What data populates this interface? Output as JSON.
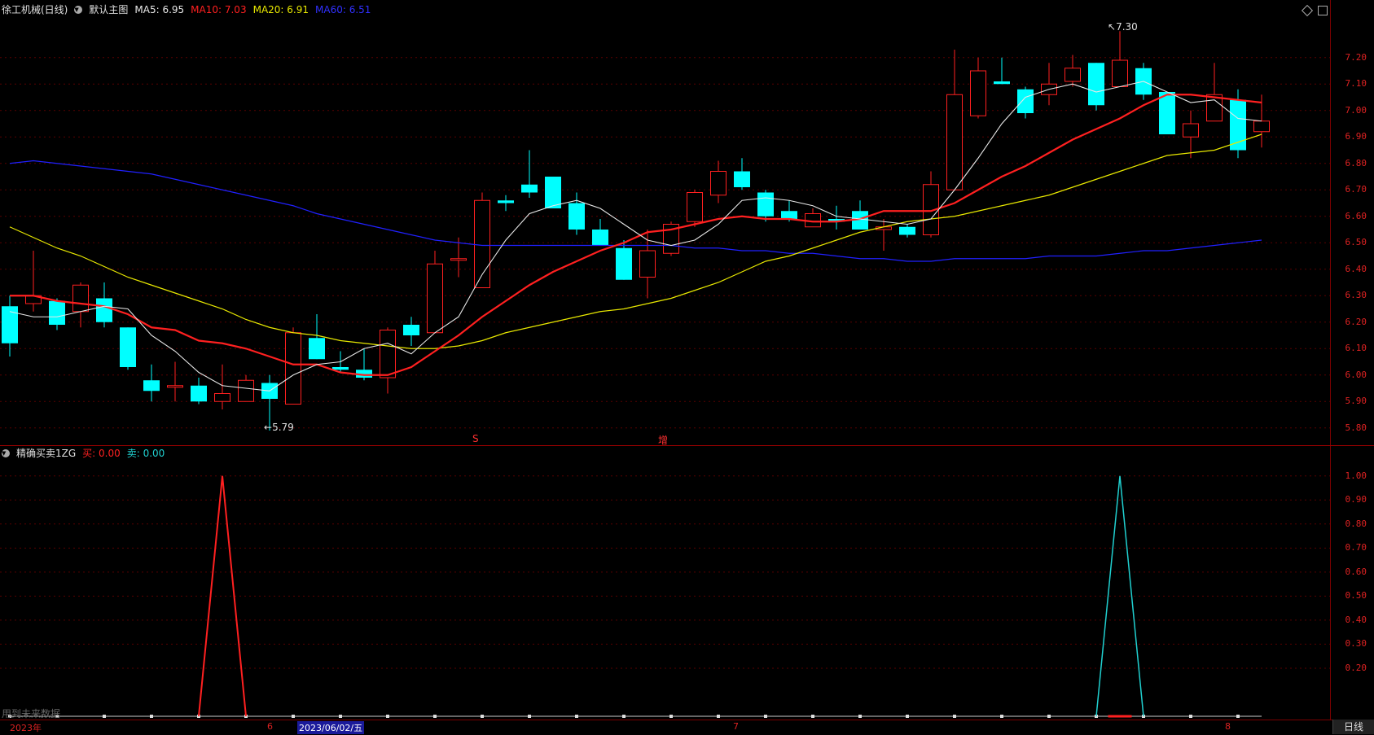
{
  "main_header": {
    "title": "徐工机械(日线)",
    "template_label": "默认主图",
    "template_icon": "chevron-down-icon",
    "ma5": {
      "label": "MA5: 6.95",
      "color": "#e8e8e8"
    },
    "ma10": {
      "label": "MA10: 7.03",
      "color": "#ff2020"
    },
    "ma20": {
      "label": "MA20: 6.91",
      "color": "#e8e800"
    },
    "ma60": {
      "label": "MA60: 6.51",
      "color": "#2020ff"
    }
  },
  "window_controls": {
    "diamond_icon": "diamond-icon",
    "maximize_icon": "window-icon"
  },
  "price_axis": {
    "min": 5.75,
    "max": 7.35,
    "labels": [
      "7.20",
      "7.10",
      "7.00",
      "6.90",
      "6.80",
      "6.70",
      "6.60",
      "6.50",
      "6.40",
      "6.30",
      "6.20",
      "6.10",
      "6.00",
      "5.90",
      "5.80"
    ]
  },
  "price_annotations": {
    "high": "7.30",
    "low": "5.79",
    "event_s": "S",
    "event_zeng": "增"
  },
  "indicator_header": {
    "title": "精确买卖1ZG",
    "buy_label": "买: 0.00",
    "sell_label": "卖: 0.00",
    "buy_color": "#ff2020",
    "sell_color": "#20d0d0"
  },
  "indicator_axis": {
    "labels": [
      "1.00",
      "0.90",
      "0.80",
      "0.70",
      "0.60",
      "0.50",
      "0.40",
      "0.30",
      "0.20"
    ]
  },
  "footer": {
    "year_label": "2023年",
    "m6": "6",
    "selected_date": "2023/06/02/五",
    "m7": "7",
    "m8": "8",
    "mode": "日线",
    "watermark": "用到未来数据"
  },
  "chart_data": {
    "type": "candlestick",
    "up_color": "#ff2020",
    "down_color": "#00ffff",
    "candles": [
      [
        6.26,
        6.12,
        6.3,
        6.07
      ],
      [
        6.27,
        6.3,
        6.47,
        6.24
      ],
      [
        6.28,
        6.19,
        6.29,
        6.17
      ],
      [
        6.24,
        6.34,
        6.35,
        6.18
      ],
      [
        6.29,
        6.2,
        6.35,
        6.18
      ],
      [
        6.18,
        6.03,
        6.18,
        6.02
      ],
      [
        5.98,
        5.94,
        6.04,
        5.9
      ],
      [
        5.96,
        5.96,
        6.05,
        5.9
      ],
      [
        5.96,
        5.9,
        5.99,
        5.89
      ],
      [
        5.9,
        5.93,
        6.04,
        5.87
      ],
      [
        5.9,
        5.98,
        6.0,
        5.9
      ],
      [
        5.97,
        5.91,
        6.0,
        5.79
      ],
      [
        5.89,
        6.16,
        6.18,
        5.89
      ],
      [
        6.14,
        6.06,
        6.23,
        6.06
      ],
      [
        6.03,
        6.02,
        6.09,
        6.01
      ],
      [
        6.02,
        5.99,
        6.1,
        5.98
      ],
      [
        5.99,
        6.17,
        6.18,
        5.93
      ],
      [
        6.19,
        6.15,
        6.22,
        6.11
      ],
      [
        6.16,
        6.42,
        6.47,
        6.16
      ],
      [
        6.44,
        6.44,
        6.52,
        6.37
      ],
      [
        6.33,
        6.66,
        6.69,
        6.33
      ],
      [
        6.66,
        6.65,
        6.68,
        6.62
      ],
      [
        6.72,
        6.69,
        6.85,
        6.67
      ],
      [
        6.75,
        6.63,
        6.75,
        6.63
      ],
      [
        6.65,
        6.55,
        6.69,
        6.53
      ],
      [
        6.55,
        6.49,
        6.59,
        6.49
      ],
      [
        6.48,
        6.36,
        6.51,
        6.36
      ],
      [
        6.37,
        6.47,
        6.55,
        6.29
      ],
      [
        6.46,
        6.57,
        6.58,
        6.45
      ],
      [
        6.58,
        6.69,
        6.7,
        6.56
      ],
      [
        6.68,
        6.77,
        6.81,
        6.65
      ],
      [
        6.77,
        6.71,
        6.82,
        6.7
      ],
      [
        6.69,
        6.6,
        6.7,
        6.58
      ],
      [
        6.62,
        6.59,
        6.66,
        6.58
      ],
      [
        6.56,
        6.61,
        6.63,
        6.56
      ],
      [
        6.59,
        6.58,
        6.64,
        6.55
      ],
      [
        6.62,
        6.55,
        6.66,
        6.55
      ],
      [
        6.55,
        6.56,
        6.59,
        6.47
      ],
      [
        6.56,
        6.53,
        6.57,
        6.52
      ],
      [
        6.53,
        6.72,
        6.77,
        6.52
      ],
      [
        6.7,
        7.06,
        7.23,
        6.7
      ],
      [
        6.98,
        7.15,
        7.2,
        6.97
      ],
      [
        7.11,
        7.1,
        7.2,
        7.1
      ],
      [
        7.08,
        6.99,
        7.09,
        6.97
      ],
      [
        7.06,
        7.1,
        7.18,
        7.02
      ],
      [
        7.11,
        7.16,
        7.21,
        7.09
      ],
      [
        7.18,
        7.02,
        7.18,
        7.0
      ],
      [
        7.09,
        7.19,
        7.3,
        7.09
      ],
      [
        7.16,
        7.06,
        7.18,
        7.04
      ],
      [
        7.07,
        6.91,
        7.07,
        6.91
      ],
      [
        6.9,
        6.95,
        7.0,
        6.82
      ],
      [
        6.96,
        7.06,
        7.18,
        6.96
      ],
      [
        7.04,
        6.85,
        7.08,
        6.82
      ],
      [
        6.92,
        6.96,
        7.06,
        6.86
      ]
    ],
    "ma5": [
      6.24,
      6.22,
      6.22,
      6.24,
      6.26,
      6.25,
      6.15,
      6.09,
      6.01,
      5.96,
      5.95,
      5.94,
      6.0,
      6.04,
      6.05,
      6.1,
      6.12,
      6.08,
      6.16,
      6.22,
      6.38,
      6.51,
      6.61,
      6.64,
      6.66,
      6.63,
      6.57,
      6.51,
      6.49,
      6.51,
      6.57,
      6.66,
      6.67,
      6.66,
      6.64,
      6.6,
      6.59,
      6.58,
      6.57,
      6.59,
      6.7,
      6.82,
      6.95,
      7.05,
      7.08,
      7.1,
      7.07,
      7.09,
      7.11,
      7.07,
      7.03,
      7.04,
      6.97,
      6.96
    ],
    "ma10": [
      6.3,
      6.3,
      6.28,
      6.27,
      6.26,
      6.23,
      6.18,
      6.17,
      6.13,
      6.12,
      6.1,
      6.07,
      6.04,
      6.04,
      6.01,
      6.0,
      6.0,
      6.03,
      6.09,
      6.15,
      6.22,
      6.28,
      6.34,
      6.39,
      6.43,
      6.47,
      6.5,
      6.54,
      6.55,
      6.57,
      6.59,
      6.6,
      6.59,
      6.59,
      6.58,
      6.58,
      6.59,
      6.62,
      6.62,
      6.62,
      6.65,
      6.7,
      6.75,
      6.79,
      6.84,
      6.89,
      6.93,
      6.97,
      7.02,
      7.06,
      7.06,
      7.05,
      7.04,
      7.03
    ],
    "ma20": [
      6.56,
      6.52,
      6.48,
      6.45,
      6.41,
      6.37,
      6.34,
      6.31,
      6.28,
      6.25,
      6.21,
      6.18,
      6.16,
      6.15,
      6.13,
      6.12,
      6.11,
      6.1,
      6.1,
      6.11,
      6.13,
      6.16,
      6.18,
      6.2,
      6.22,
      6.24,
      6.25,
      6.27,
      6.29,
      6.32,
      6.35,
      6.39,
      6.43,
      6.45,
      6.48,
      6.51,
      6.54,
      6.56,
      6.58,
      6.59,
      6.6,
      6.62,
      6.64,
      6.66,
      6.68,
      6.71,
      6.74,
      6.77,
      6.8,
      6.83,
      6.84,
      6.85,
      6.88,
      6.91
    ],
    "ma60": [
      6.8,
      6.81,
      6.8,
      6.79,
      6.78,
      6.77,
      6.76,
      6.74,
      6.72,
      6.7,
      6.68,
      6.66,
      6.64,
      6.61,
      6.59,
      6.57,
      6.55,
      6.53,
      6.51,
      6.5,
      6.49,
      6.49,
      6.49,
      6.49,
      6.49,
      6.49,
      6.49,
      6.49,
      6.49,
      6.48,
      6.48,
      6.47,
      6.47,
      6.46,
      6.46,
      6.45,
      6.44,
      6.44,
      6.43,
      6.43,
      6.44,
      6.44,
      6.44,
      6.44,
      6.45,
      6.45,
      6.45,
      6.46,
      6.47,
      6.47,
      6.48,
      6.49,
      6.5,
      6.51
    ],
    "indicator": {
      "type": "line",
      "buy_spike_index": 9,
      "sell_spike_index": 47,
      "ylim": [
        0,
        1.05
      ]
    }
  }
}
